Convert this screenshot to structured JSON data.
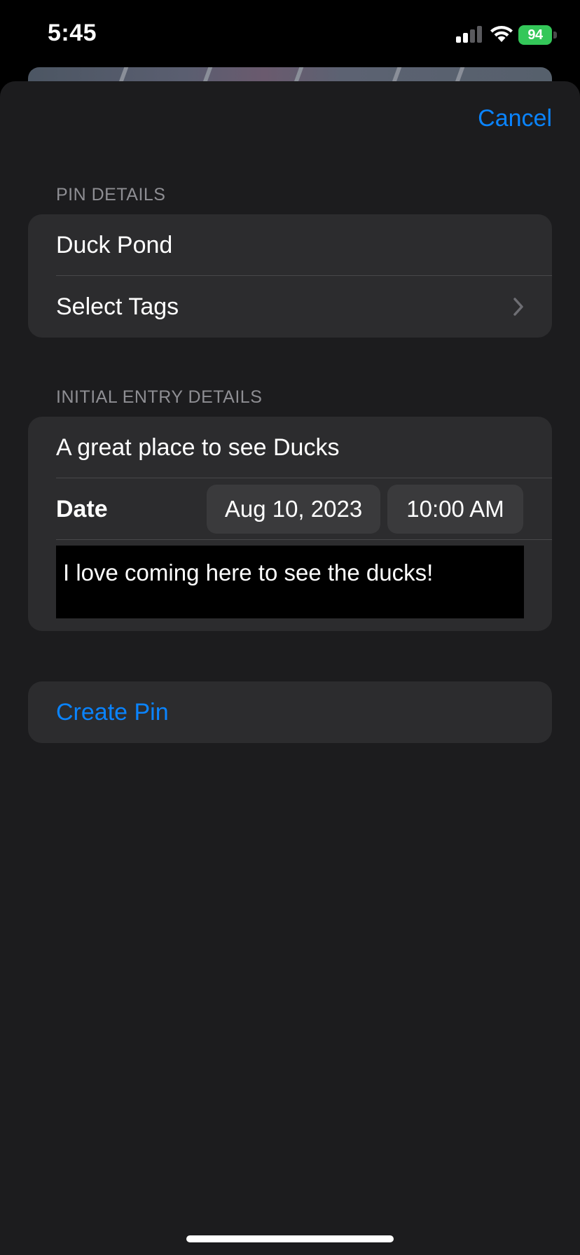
{
  "status_bar": {
    "time": "5:45",
    "battery_level": "94",
    "icons": [
      "signal-icon",
      "wifi-icon",
      "battery-charging-icon"
    ],
    "battery_color": "#34c759"
  },
  "sheet": {
    "cancel_label": "Cancel",
    "pin_details": {
      "header": "PIN DETAILS",
      "name_value": "Duck Pond",
      "tags_label": "Select Tags"
    },
    "entry_details": {
      "header": "INITIAL ENTRY DETAILS",
      "title_value": "A great place to see Ducks",
      "date_label": "Date",
      "date_value": "Aug 10, 2023",
      "time_value": "10:00 AM",
      "notes_value": "I love coming here to see the ducks!"
    },
    "create_label": "Create Pin"
  },
  "colors": {
    "accent": "#0a84ff",
    "sheet_background": "#1c1c1e",
    "group_background": "#2c2c2e",
    "secondary_text": "#8e8e93"
  }
}
